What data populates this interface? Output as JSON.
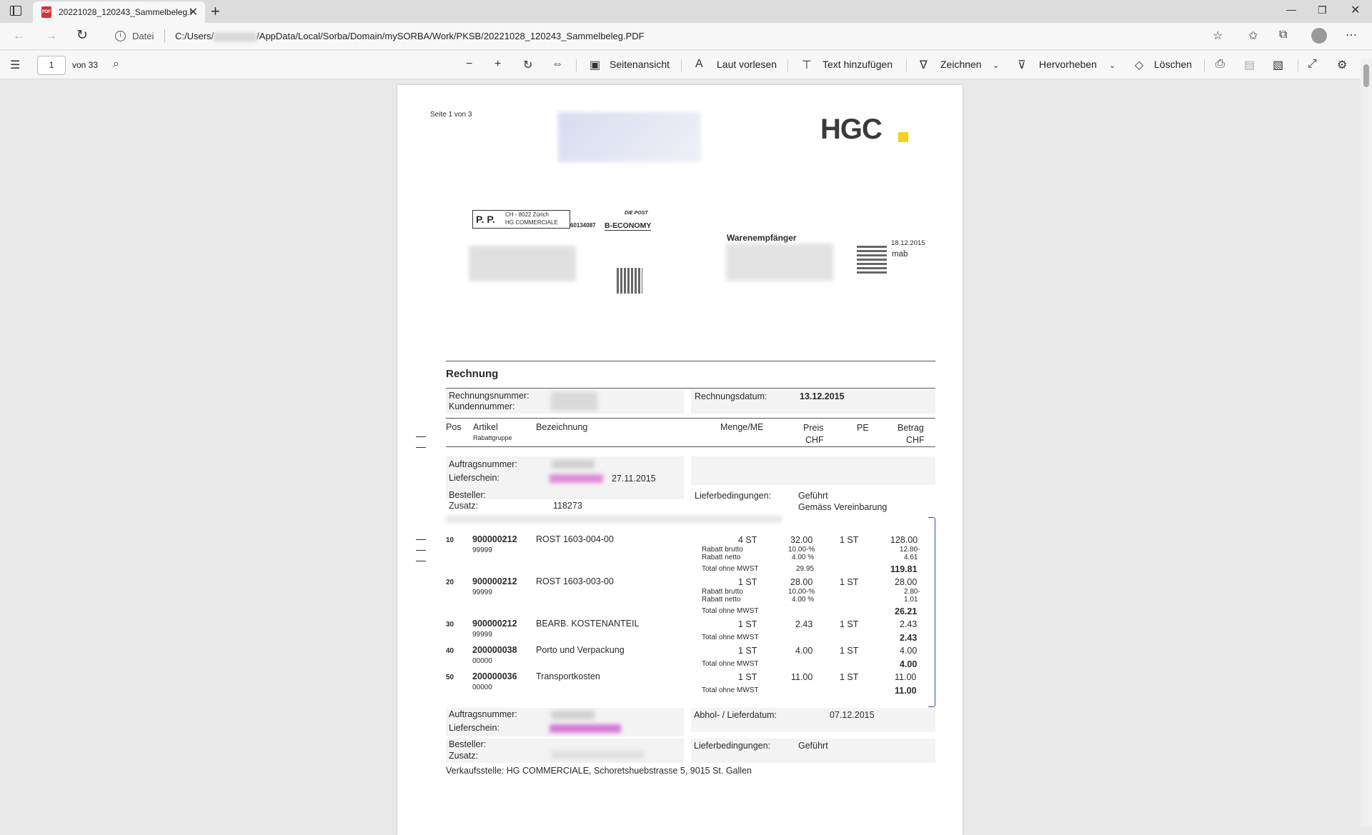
{
  "tab": {
    "title": "20221028_120243_Sammelbeleg.PDF",
    "close": "✕"
  },
  "address": {
    "scheme": "Datei",
    "url_prefix": "C:/Users/",
    "url_suffix": "/AppData/Local/Sorba/Domain/mySORBA/Work/PKSB/20221028_120243_Sammelbeleg.PDF"
  },
  "pdf_toolbar": {
    "page_current": "1",
    "page_total": "von 33",
    "page_view": "Seitenansicht",
    "read_aloud": "Laut vorlesen",
    "add_text": "Text hinzufügen",
    "draw": "Zeichnen",
    "highlight": "Hervorheben",
    "erase": "Löschen"
  },
  "doc": {
    "page_info": "Seite 1 von 3",
    "logo": "HGC",
    "pp": "P. P.",
    "pp_city": "CH - 8022 Zürich",
    "pp_company": "HG COMMERCIALE",
    "post_number": "60134087",
    "die_post": "DIE POST",
    "b_economy": "B-ECONOMY",
    "recipient_heading": "Warenempfänger",
    "qr_date": "18.12.2015",
    "qr_user": "mab",
    "title": "Rechnung",
    "invoice_number_label": "Rechnungsnummer:",
    "customer_number_label": "Kundennummer:",
    "invoice_date_label": "Rechnungsdatum:",
    "invoice_date": "13.12.2015",
    "columns": {
      "pos": "Pos",
      "artikel": "Artikel",
      "rabattgruppe": "Rabattgruppe",
      "bezeichnung": "Bezeichnung",
      "menge": "Menge/ME",
      "preis": "Preis",
      "pe": "PE",
      "betrag": "Betrag",
      "chf": "CHF"
    },
    "block1": {
      "auftrag_label": "Auftragsnummer:",
      "lieferschein_label": "Lieferschein:",
      "lieferschein_date": "27.11.2015",
      "besteller_label": "Besteller:",
      "zusatz_label": "Zusatz:",
      "zusatz": "118273",
      "liefer_label": "Lieferbedingungen:",
      "liefer1": "Geführt",
      "liefer2": "Gemäss Vereinbarung"
    },
    "rabatt_brutto": "Rabatt brutto",
    "rabatt_netto": "Rabatt netto",
    "total_label": "Total ohne MWST",
    "items": [
      {
        "pos": "10",
        "artikel": "900000212",
        "gruppe": "99999",
        "bez": "ROST 1603-004-00",
        "menge": "4 ST",
        "preis": "32.00",
        "pe": "1 ST",
        "betrag": "128.00",
        "rb_pct": "10.00-%",
        "rb_val": "12.80-",
        "rn_pct": "4.00 %",
        "rn_val": "4.61",
        "total_pe": "29.95",
        "total": "119.81"
      },
      {
        "pos": "20",
        "artikel": "900000212",
        "gruppe": "99999",
        "bez": "ROST 1603-003-00",
        "menge": "1 ST",
        "preis": "28.00",
        "pe": "1 ST",
        "betrag": "28.00",
        "rb_pct": "10.00-%",
        "rb_val": "2.80-",
        "rn_pct": "4.00 %",
        "rn_val": "1.01",
        "total": "26.21"
      },
      {
        "pos": "30",
        "artikel": "900000212",
        "gruppe": "99999",
        "bez": "BEARB. KOSTENANTEIL",
        "menge": "1 ST",
        "preis": "2.43",
        "pe": "1 ST",
        "betrag": "2.43",
        "total": "2.43"
      },
      {
        "pos": "40",
        "artikel": "200000038",
        "gruppe": "00000",
        "bez": "Porto und Verpackung",
        "menge": "1 ST",
        "preis": "4.00",
        "pe": "1 ST",
        "betrag": "4.00",
        "total": "4.00"
      },
      {
        "pos": "50",
        "artikel": "200000036",
        "gruppe": "00000",
        "bez": "Transportkosten",
        "menge": "1 ST",
        "preis": "11.00",
        "pe": "1 ST",
        "betrag": "11.00",
        "total": "11.00"
      }
    ],
    "block2": {
      "auftrag_label": "Auftragsnummer:",
      "lieferschein_label": "Lieferschein:",
      "abhol_label": "Abhol- / Lieferdatum:",
      "abhol_date": "07.12.2015",
      "besteller_label": "Besteller:",
      "zusatz_label": "Zusatz:",
      "liefer_label": "Lieferbedingungen:",
      "liefer1": "Geführt"
    },
    "verkaufsstelle": "Verkaufsstelle: HG COMMERCIALE, Schoretshuebstrasse 5, 9015 St. Gallen"
  }
}
